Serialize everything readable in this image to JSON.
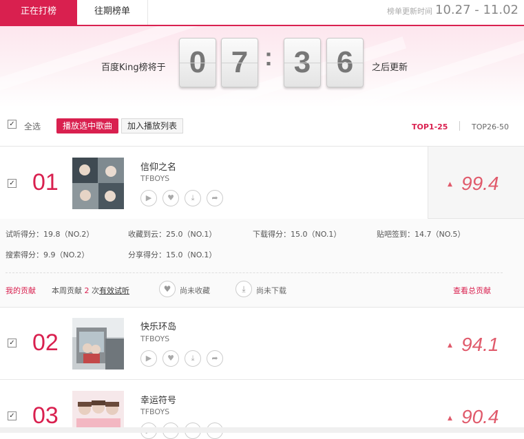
{
  "tabs": {
    "current": "正在打榜",
    "past": "往期榜单"
  },
  "update": {
    "label": "榜单更新时间",
    "range": "10.27 - 11.02"
  },
  "countdown": {
    "prefix": "百度King榜将于",
    "d1": "0",
    "d2": "7",
    "d3": "3",
    "d4": "6",
    "suffix": "之后更新"
  },
  "toolbar": {
    "select_all": "全选",
    "play_selected": "播放选中歌曲",
    "add_playlist": "加入播放列表",
    "range_active": "TOP1-25",
    "range_other": "TOP26-50"
  },
  "songs": [
    {
      "rank": "01",
      "title": "信仰之名",
      "artist": "TFBOYS",
      "score": "99.4"
    },
    {
      "rank": "02",
      "title": "快乐环岛",
      "artist": "TFBOYS",
      "score": "94.1"
    },
    {
      "rank": "03",
      "title": "幸运符号",
      "artist": "TFBOYS",
      "score": "90.4"
    }
  ],
  "details": {
    "listen": "试听得分：19.8（NO.2）",
    "collect": "收藏到云：25.0（NO.1）",
    "download": "下载得分：15.0（NO.1）",
    "tieba": "贴吧签到：14.7（NO.5）",
    "search": "搜索得分：9.9（NO.2）",
    "share": "分享得分：15.0（NO.1）"
  },
  "contribution": {
    "mine": "我的贡献",
    "week_prefix": "本周贡献",
    "week_count": "2",
    "week_mid": "次",
    "week_link": "有效试听",
    "not_collected": "尚未收藏",
    "not_downloaded": "尚未下载",
    "view_total": "查看总贡献"
  },
  "colors": {
    "accent": "#d9204f",
    "score": "#e05a6b"
  },
  "icons": [
    "play-icon",
    "heart-icon",
    "download-icon",
    "share-icon",
    "up-arrow-icon",
    "check-icon"
  ]
}
